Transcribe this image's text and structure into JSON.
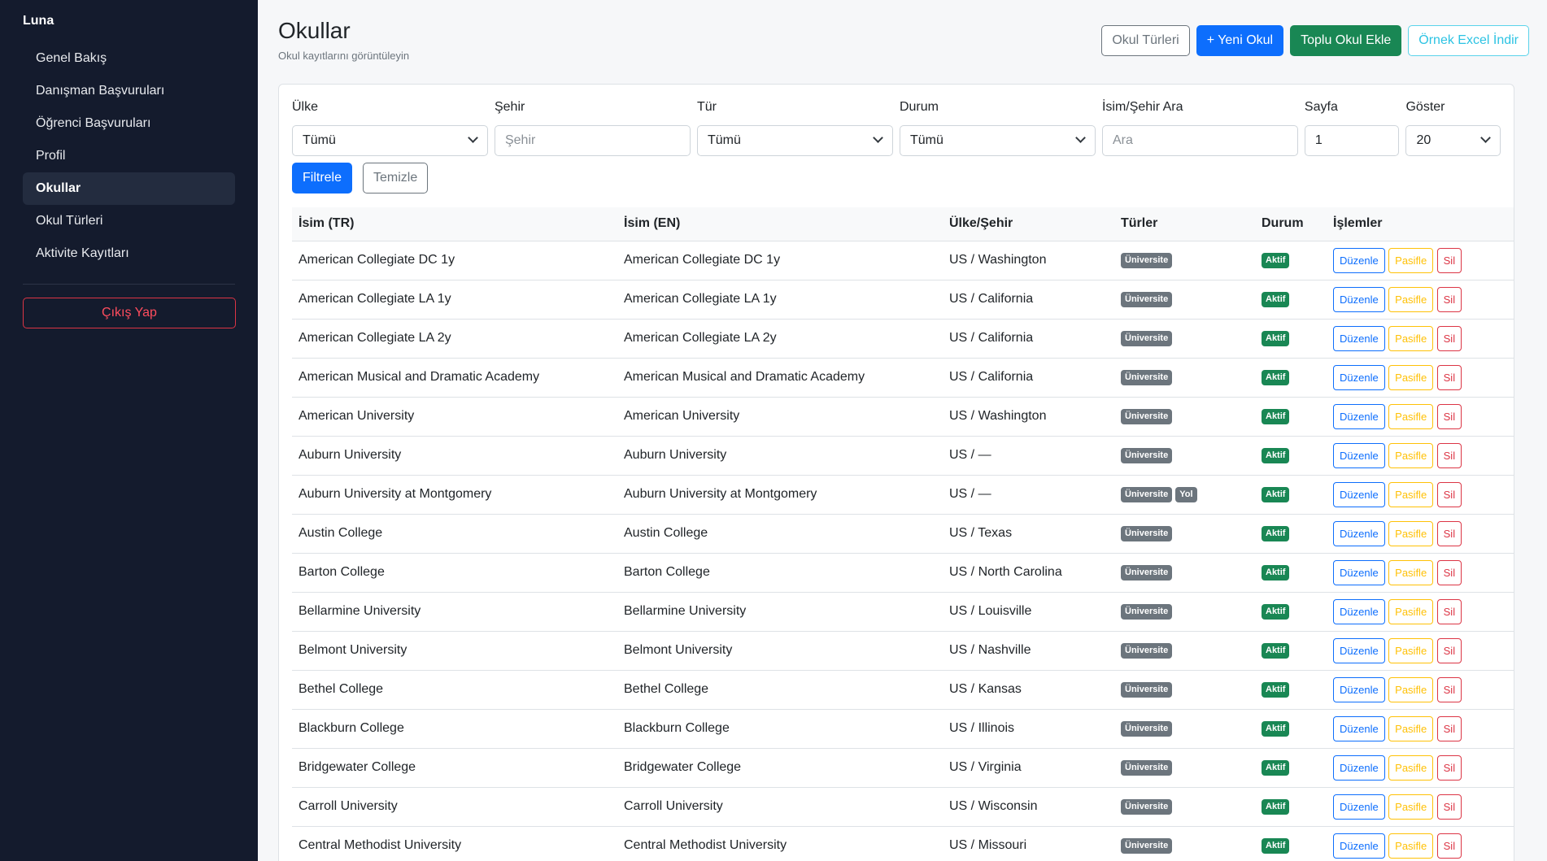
{
  "sidebar": {
    "brand": "Luna",
    "items": [
      {
        "label": "Genel Bakış",
        "active": false
      },
      {
        "label": "Danışman Başvuruları",
        "active": false
      },
      {
        "label": "Öğrenci Başvuruları",
        "active": false
      },
      {
        "label": "Profil",
        "active": false
      },
      {
        "label": "Okullar",
        "active": true
      },
      {
        "label": "Okul Türleri",
        "active": false
      },
      {
        "label": "Aktivite Kayıtları",
        "active": false
      }
    ],
    "logout_label": "Çıkış Yap"
  },
  "header": {
    "title": "Okullar",
    "subtitle": "Okul kayıtlarını görüntüleyin",
    "buttons": {
      "types": "Okul Türleri",
      "new": "+ Yeni Okul",
      "bulk": "Toplu Okul Ekle",
      "excel": "Örnek Excel İndir"
    }
  },
  "filters": {
    "country": {
      "label": "Ülke",
      "value": "Tümü"
    },
    "city": {
      "label": "Şehir",
      "placeholder": "Şehir"
    },
    "type": {
      "label": "Tür",
      "value": "Tümü"
    },
    "status": {
      "label": "Durum",
      "value": "Tümü"
    },
    "search": {
      "label": "İsim/Şehir Ara",
      "placeholder": "Ara"
    },
    "page": {
      "label": "Sayfa",
      "value": "1"
    },
    "show": {
      "label": "Göster",
      "value": "20"
    },
    "filter_button": "Filtrele",
    "clear_button": "Temizle"
  },
  "table": {
    "headers": [
      "İsim (TR)",
      "İsim (EN)",
      "Ülke/Şehir",
      "Türler",
      "Durum",
      "İşlemler"
    ],
    "actions": {
      "edit": "Düzenle",
      "passive": "Pasifle",
      "delete": "Sil"
    },
    "rows": [
      {
        "tr": "American Collegiate DC 1y",
        "en": "American Collegiate DC 1y",
        "loc": "US / Washington",
        "types": [
          "Üniversite"
        ],
        "status": "Aktif"
      },
      {
        "tr": "American Collegiate LA 1y",
        "en": "American Collegiate LA 1y",
        "loc": "US / California",
        "types": [
          "Üniversite"
        ],
        "status": "Aktif"
      },
      {
        "tr": "American Collegiate LA 2y",
        "en": "American Collegiate LA 2y",
        "loc": "US / California",
        "types": [
          "Üniversite"
        ],
        "status": "Aktif"
      },
      {
        "tr": "American Musical and Dramatic Academy",
        "en": "American Musical and Dramatic Academy",
        "loc": "US / California",
        "types": [
          "Üniversite"
        ],
        "status": "Aktif"
      },
      {
        "tr": "American University",
        "en": "American University",
        "loc": "US / Washington",
        "types": [
          "Üniversite"
        ],
        "status": "Aktif"
      },
      {
        "tr": "Auburn University",
        "en": "Auburn University",
        "loc": "US / —",
        "types": [
          "Üniversite"
        ],
        "status": "Aktif"
      },
      {
        "tr": "Auburn University at Montgomery",
        "en": "Auburn University at Montgomery",
        "loc": "US / —",
        "types": [
          "Üniversite",
          "Yol"
        ],
        "status": "Aktif"
      },
      {
        "tr": "Austin College",
        "en": "Austin College",
        "loc": "US / Texas",
        "types": [
          "Üniversite"
        ],
        "status": "Aktif"
      },
      {
        "tr": "Barton College",
        "en": "Barton College",
        "loc": "US / North Carolina",
        "types": [
          "Üniversite"
        ],
        "status": "Aktif"
      },
      {
        "tr": "Bellarmine University",
        "en": "Bellarmine University",
        "loc": "US / Louisville",
        "types": [
          "Üniversite"
        ],
        "status": "Aktif"
      },
      {
        "tr": "Belmont University",
        "en": "Belmont University",
        "loc": "US / Nashville",
        "types": [
          "Üniversite"
        ],
        "status": "Aktif"
      },
      {
        "tr": "Bethel College",
        "en": "Bethel College",
        "loc": "US / Kansas",
        "types": [
          "Üniversite"
        ],
        "status": "Aktif"
      },
      {
        "tr": "Blackburn College",
        "en": "Blackburn College",
        "loc": "US / Illinois",
        "types": [
          "Üniversite"
        ],
        "status": "Aktif"
      },
      {
        "tr": "Bridgewater College",
        "en": "Bridgewater College",
        "loc": "US / Virginia",
        "types": [
          "Üniversite"
        ],
        "status": "Aktif"
      },
      {
        "tr": "Carroll University",
        "en": "Carroll University",
        "loc": "US / Wisconsin",
        "types": [
          "Üniversite"
        ],
        "status": "Aktif"
      },
      {
        "tr": "Central Methodist University",
        "en": "Central Methodist University",
        "loc": "US / Missouri",
        "types": [
          "Üniversite"
        ],
        "status": "Aktif"
      }
    ]
  }
}
